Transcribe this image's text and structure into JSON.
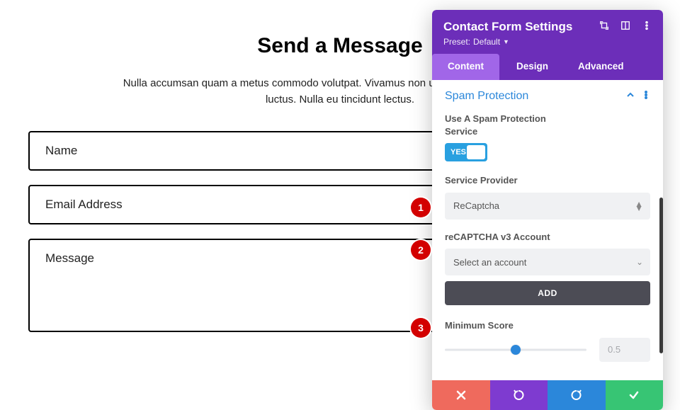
{
  "page": {
    "title": "Send a Message",
    "intro": "Nulla accumsan quam a metus commodo volutpat. Vivamus non urna sit amet urna faucibus luctus. Nulla eu tincidunt lectus.",
    "fields": {
      "name": "Name",
      "email": "Email Address",
      "message": "Message"
    }
  },
  "steps": {
    "one": "1",
    "two": "2",
    "three": "3"
  },
  "panel": {
    "title": "Contact Form Settings",
    "preset_label": "Preset:",
    "preset_value": "Default",
    "tabs": {
      "content": "Content",
      "design": "Design",
      "advanced": "Advanced"
    },
    "section": {
      "title": "Spam Protection"
    },
    "spam": {
      "use_label": "Use A Spam Protection Service",
      "toggle_text": "YES",
      "provider_label": "Service Provider",
      "provider_value": "ReCaptcha",
      "account_label": "reCAPTCHA v3 Account",
      "account_value": "Select an account",
      "add_label": "ADD",
      "score_label": "Minimum Score",
      "score_value": "0.5",
      "score_pct": 50
    }
  }
}
